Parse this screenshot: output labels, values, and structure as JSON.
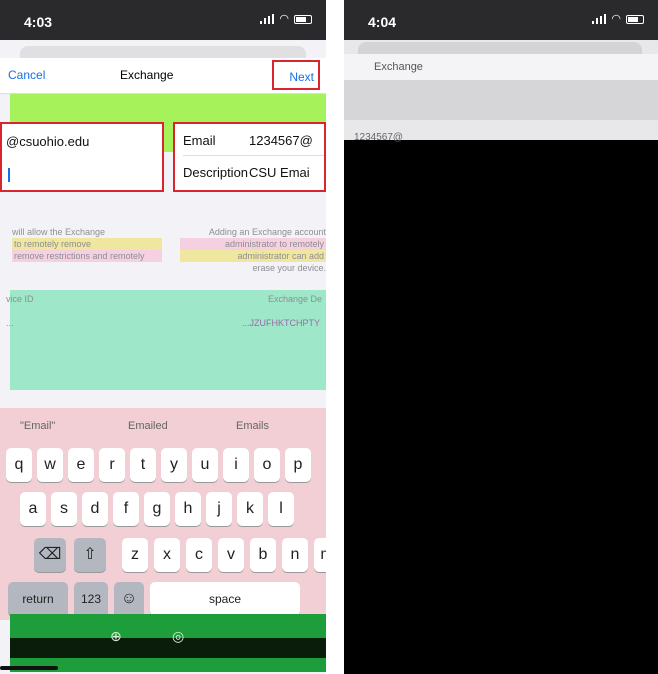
{
  "left": {
    "status": {
      "time": "4:03"
    },
    "nav": {
      "cancel": "Cancel",
      "title": "Exchange",
      "next": "Next"
    },
    "email_value": "@csuohio.edu",
    "form": {
      "email_label": "Email",
      "email_value": "1234567@",
      "description_label": "Description",
      "description_value": "CSU Emai"
    },
    "notes": {
      "left": [
        "will allow the Exchange",
        "to remotely remove",
        "remove restrictions and remotely"
      ],
      "right": [
        "Adding an Exchange account",
        "administrator to remotely",
        "administrator can add",
        "erase your device."
      ]
    },
    "device": {
      "label": "vice ID",
      "exchange_label": "Exchange De",
      "value_left": "...",
      "value_right": "...JZUFHKTCHPTY"
    },
    "keyboard": {
      "suggestions": [
        "\"Email\"",
        "Emailed",
        "Emails"
      ],
      "row1": [
        "q",
        "w",
        "e",
        "r",
        "t",
        "y",
        "u",
        "i",
        "o",
        "p"
      ],
      "row2": [
        "a",
        "s",
        "d",
        "f",
        "g",
        "h",
        "j",
        "k",
        "l"
      ],
      "row3": [
        "z",
        "x",
        "c",
        "v",
        "b",
        "n",
        "m"
      ],
      "return": "return",
      "numbers": "123",
      "space": "space"
    }
  },
  "right": {
    "status": {
      "time": "4:04"
    },
    "nav_text": "Exchange",
    "row_text": "1234567@"
  },
  "colors": {
    "accent": "#1a6ee6",
    "highlight": "#d9262e"
  }
}
